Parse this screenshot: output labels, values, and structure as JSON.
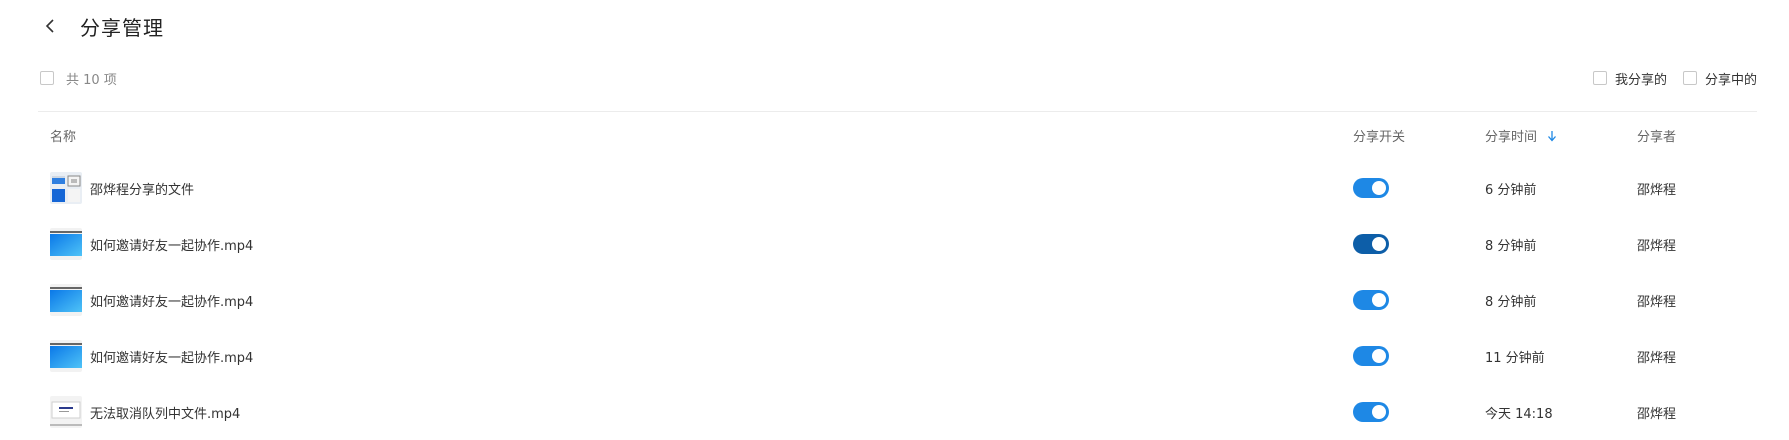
{
  "header": {
    "title": "分享管理"
  },
  "toolbar": {
    "count_label": "共 10 项",
    "filters": [
      {
        "label": "我分享的"
      },
      {
        "label": "分享中的"
      }
    ]
  },
  "table": {
    "columns": {
      "name": "名称",
      "toggle": "分享开关",
      "time": "分享时间",
      "owner": "分享者"
    },
    "sort": {
      "column": "time",
      "direction": "desc",
      "icon": "arrow-down-icon",
      "color": "#1e88e5"
    },
    "rows": [
      {
        "name": "邵烨程分享的文件",
        "thumb": "folder-collage-thumbnail",
        "enabled": true,
        "time": "6 分钟前",
        "owner": "邵烨程"
      },
      {
        "name": "如何邀请好友一起协作.mp4",
        "thumb": "video-thumbnail",
        "enabled": true,
        "time": "8 分钟前",
        "owner": "邵烨程"
      },
      {
        "name": "如何邀请好友一起协作.mp4",
        "thumb": "video-thumbnail",
        "enabled": true,
        "time": "8 分钟前",
        "owner": "邵烨程"
      },
      {
        "name": "如何邀请好友一起协作.mp4",
        "thumb": "video-thumbnail",
        "enabled": true,
        "time": "11 分钟前",
        "owner": "邵烨程"
      },
      {
        "name": "无法取消队列中文件.mp4",
        "thumb": "video-screen-thumbnail",
        "enabled": true,
        "time": "今天 14:18",
        "owner": "邵烨程"
      }
    ]
  },
  "colors": {
    "toggle_on": "#1e88e5",
    "toggle_on_hover": "#0d5ea8"
  }
}
